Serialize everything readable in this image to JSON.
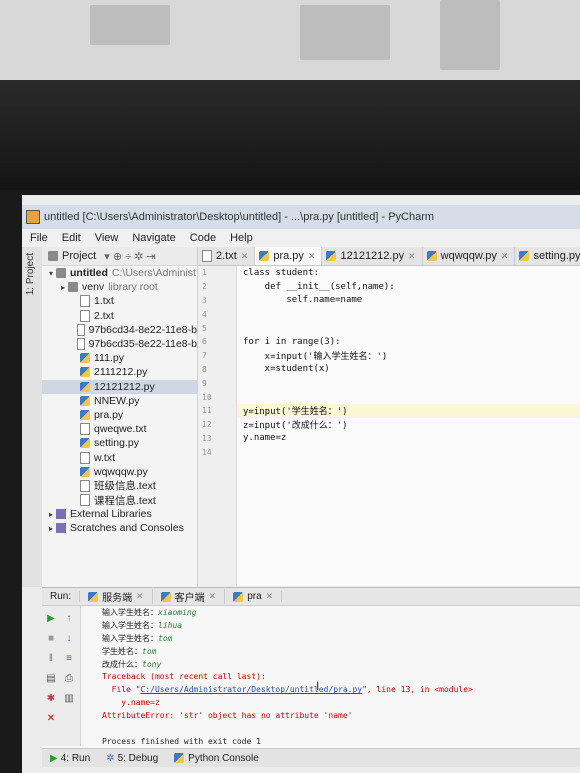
{
  "window": {
    "title": "untitled [C:\\Users\\Administrator\\Desktop\\untitled] - ...\\pra.py [untitled] - PyCharm"
  },
  "menu": [
    "File",
    "Edit",
    "View",
    "Navigate",
    "Code",
    "Help"
  ],
  "sidebar": {
    "tool_window": "1: Project"
  },
  "project": {
    "header": "Project",
    "tree": [
      {
        "label": "untitled",
        "extra": "C:\\Users\\Administ",
        "icon": "folder",
        "indent": 0,
        "arrow": "v"
      },
      {
        "label": "venv",
        "extra": "library root",
        "icon": "folder",
        "indent": 1,
        "arrow": ">"
      },
      {
        "label": "1.txt",
        "icon": "txt",
        "indent": 2
      },
      {
        "label": "2.txt",
        "icon": "txt",
        "indent": 2
      },
      {
        "label": "97b6cd34-8e22-11e8-b",
        "icon": "txt",
        "indent": 2
      },
      {
        "label": "97b6cd35-8e22-11e8-b",
        "icon": "txt",
        "indent": 2
      },
      {
        "label": "111.py",
        "icon": "py",
        "indent": 2
      },
      {
        "label": "2111212.py",
        "icon": "py",
        "indent": 2
      },
      {
        "label": "12121212.py",
        "icon": "py",
        "indent": 2,
        "selected": true
      },
      {
        "label": "NNEW.py",
        "icon": "py",
        "indent": 2
      },
      {
        "label": "pra.py",
        "icon": "py",
        "indent": 2
      },
      {
        "label": "qweqwe.txt",
        "icon": "txt",
        "indent": 2
      },
      {
        "label": "setting.py",
        "icon": "py",
        "indent": 2
      },
      {
        "label": "w.txt",
        "icon": "txt",
        "indent": 2
      },
      {
        "label": "wqwqqw.py",
        "icon": "py",
        "indent": 2
      },
      {
        "label": "班级信息.text",
        "icon": "txt",
        "indent": 2
      },
      {
        "label": "课程信息.text",
        "icon": "txt",
        "indent": 2
      },
      {
        "label": "External Libraries",
        "icon": "lib",
        "indent": 0,
        "arrow": ">"
      },
      {
        "label": "Scratches and Consoles",
        "icon": "lib",
        "indent": 0,
        "arrow": ">"
      }
    ]
  },
  "editor": {
    "tabs": [
      {
        "label": "2.txt",
        "icon": "txt",
        "active": false
      },
      {
        "label": "pra.py",
        "icon": "py",
        "active": true
      },
      {
        "label": "12121212.py",
        "icon": "py",
        "active": false
      },
      {
        "label": "wqwqqw.py",
        "icon": "py",
        "active": false
      },
      {
        "label": "setting.py",
        "icon": "py",
        "active": false
      }
    ],
    "lines": [
      {
        "n": "1",
        "text": "class student:"
      },
      {
        "n": "2",
        "text": "    def __init__(self,name):"
      },
      {
        "n": "3",
        "text": "        self.name=name"
      },
      {
        "n": "4",
        "text": ""
      },
      {
        "n": "5",
        "text": ""
      },
      {
        "n": "6",
        "text": "for i in range(3):"
      },
      {
        "n": "7",
        "text": "    x=input('输入学生姓名：')"
      },
      {
        "n": "8",
        "text": "    x=student(x)"
      },
      {
        "n": "9",
        "text": ""
      },
      {
        "n": "10",
        "text": ""
      },
      {
        "n": "11",
        "text": "y=input('学生姓名：')",
        "highlight": true
      },
      {
        "n": "12",
        "text": "z=input('改成什么：')"
      },
      {
        "n": "13",
        "text": "y.name=z"
      },
      {
        "n": "14",
        "text": ""
      }
    ]
  },
  "run": {
    "label": "Run:",
    "tabs": [
      "服务端",
      "客户端",
      "pra"
    ],
    "output": [
      {
        "prefix": "输入学生姓名：",
        "value": "xiaoming",
        "kind": "input"
      },
      {
        "prefix": "输入学生姓名：",
        "value": "lihua",
        "kind": "input"
      },
      {
        "prefix": "输入学生姓名：",
        "value": "tom",
        "kind": "input"
      },
      {
        "prefix": "学生姓名：",
        "value": "tom",
        "kind": "input"
      },
      {
        "prefix": "改成什么：",
        "value": "tony",
        "kind": "input"
      },
      {
        "prefix": "Traceback (most recent call last):",
        "value": "",
        "kind": "err"
      },
      {
        "prefix": "  File \"",
        "value": "C:/Users/Administrator/Desktop/untitled/pra.py",
        "suffix": "\", line 13, in <module>",
        "kind": "link"
      },
      {
        "prefix": "    y.name=z",
        "value": "",
        "kind": "err"
      },
      {
        "prefix": "AttributeError: 'str' object has no attribute 'name'",
        "value": "",
        "kind": "err"
      },
      {
        "prefix": "",
        "value": "",
        "kind": "plain"
      },
      {
        "prefix": "Process finished with exit code 1",
        "value": "",
        "kind": "plain"
      }
    ]
  },
  "status": {
    "run": "4: Run",
    "debug": "5: Debug",
    "console": "Python Console"
  }
}
